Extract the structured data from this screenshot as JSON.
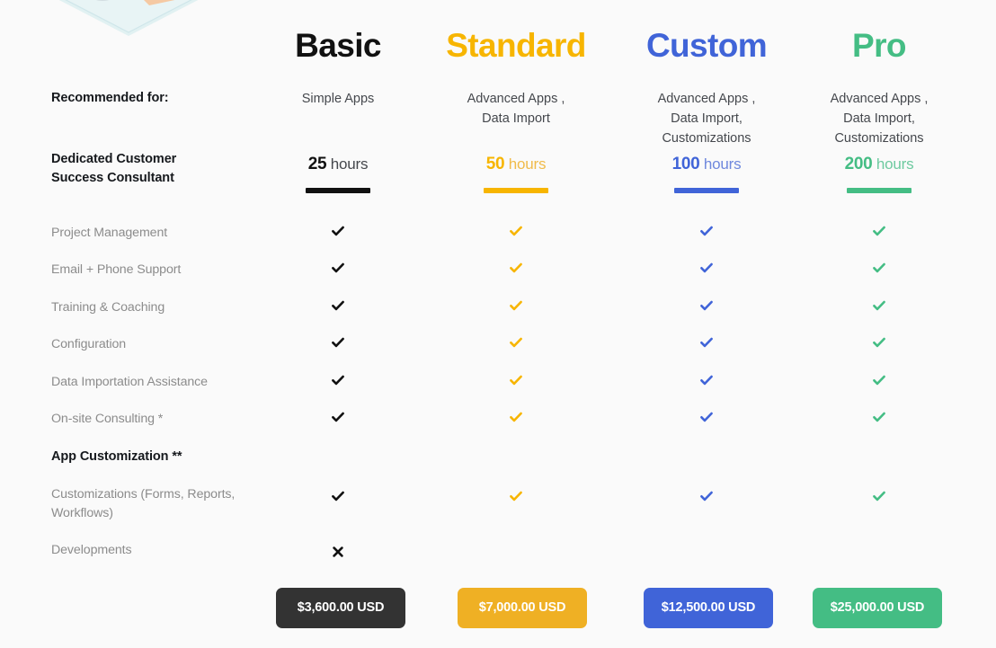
{
  "page": {
    "background_color": "#fafafa",
    "illustration_name": "isometric-desk-illustration"
  },
  "colors": {
    "basic": "#111111",
    "standard": "#f7b500",
    "custom": "#4064d8",
    "pro": "#44bd84",
    "basic_button": "#333333",
    "standard_button": "#efb024",
    "custom_button": "#4064d8",
    "pro_button": "#44bd84",
    "muted_text": "#8c8c8c",
    "dark_text": "#16191d"
  },
  "plans": [
    {
      "name": "Basic",
      "recommended_for": "Simple Apps",
      "hours_value": "25",
      "hours_unit": "hours",
      "price": "$3,600.00 USD",
      "color": "#111111"
    },
    {
      "name": "Standard",
      "recommended_for": "Advanced Apps ,\nData Import",
      "hours_value": "50",
      "hours_unit": "hours",
      "price": "$7,000.00 USD",
      "color": "#f7b500"
    },
    {
      "name": "Custom",
      "recommended_for": "Advanced Apps ,\nData Import,\nCustomizations",
      "hours_value": "100",
      "hours_unit": "hours",
      "price": "$12,500.00 USD",
      "color": "#4064d8"
    },
    {
      "name": "Pro",
      "recommended_for": "Advanced Apps ,\nData Import,\nCustomizations",
      "hours_value": "200",
      "hours_unit": "hours",
      "price": "$25,000.00 USD",
      "color": "#44bd84"
    }
  ],
  "labels": {
    "recommended_for": "Recommended for:",
    "consultant": "Dedicated Customer\nSuccess Consultant",
    "app_customization": "App Customization **"
  },
  "recommended_lines": {
    "basic": [
      "Simple Apps"
    ],
    "standard": [
      "Advanced Apps ,",
      "Data Import"
    ],
    "custom": [
      "Advanced Apps ,",
      "Data Import,",
      "Customizations"
    ],
    "pro": [
      "Advanced Apps ,",
      "Data Import,",
      "Customizations"
    ]
  },
  "consultant_lines": [
    "Dedicated Customer",
    "Success Consultant"
  ],
  "features": [
    {
      "label": "Project Management",
      "lines": [
        "Project Management"
      ],
      "marks": [
        "check",
        "check",
        "check",
        "check"
      ]
    },
    {
      "label": "Email + Phone Support",
      "lines": [
        "Email + Phone Support"
      ],
      "marks": [
        "check",
        "check",
        "check",
        "check"
      ]
    },
    {
      "label": "Training & Coaching",
      "lines": [
        "Training & Coaching"
      ],
      "marks": [
        "check",
        "check",
        "check",
        "check"
      ]
    },
    {
      "label": "Configuration",
      "lines": [
        "Configuration"
      ],
      "marks": [
        "check",
        "check",
        "check",
        "check"
      ]
    },
    {
      "label": "Data Importation Assistance",
      "lines": [
        "Data Importation Assistance"
      ],
      "marks": [
        "check",
        "check",
        "check",
        "check"
      ]
    },
    {
      "label": "On-site Consulting *",
      "lines": [
        "On-site Consulting *"
      ],
      "marks": [
        "check",
        "check",
        "check",
        "check"
      ]
    }
  ],
  "customization_features": [
    {
      "label": "Customizations (Forms, Reports, Workflows)",
      "lines": [
        "Customizations (Forms, Reports,",
        "Workflows)"
      ],
      "marks": [
        "check",
        "check",
        "check",
        "check"
      ]
    },
    {
      "label": "Developments",
      "lines": [
        "Developments"
      ],
      "marks": [
        "cross",
        "none",
        "none",
        "none"
      ]
    }
  ]
}
